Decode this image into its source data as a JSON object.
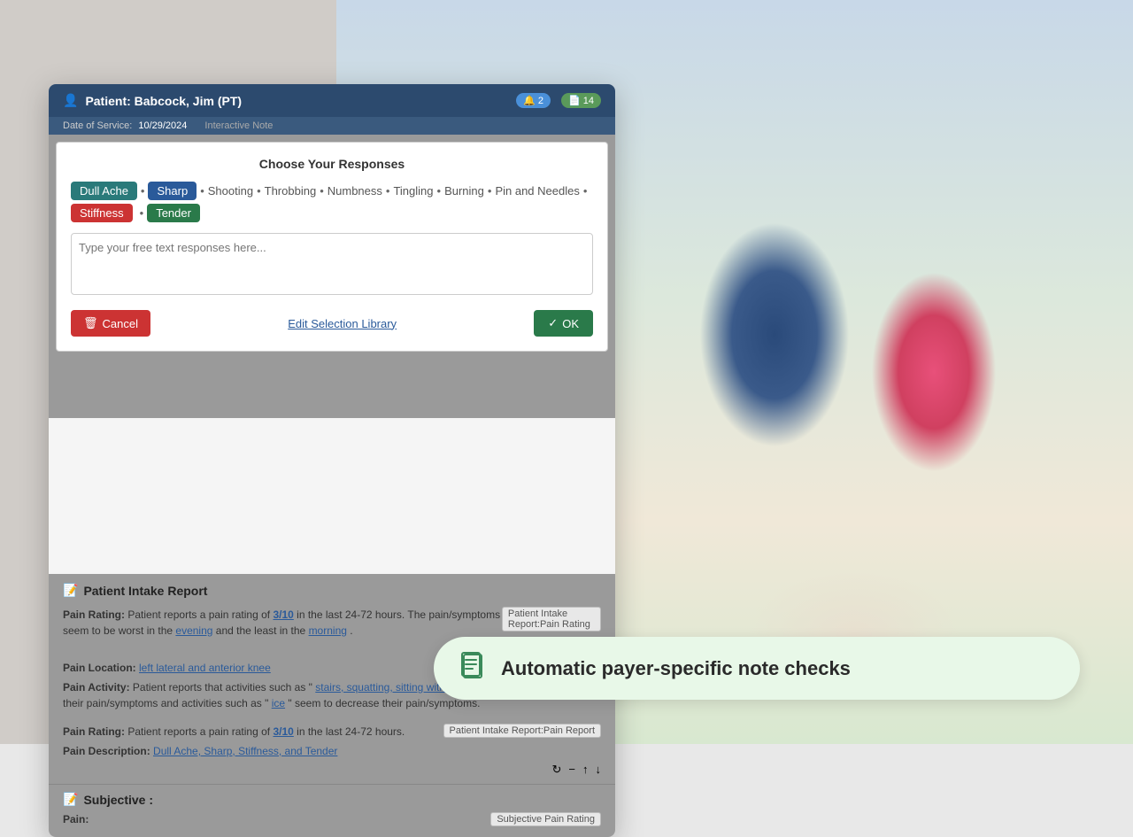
{
  "background": {
    "left_color": "#b0b0b0",
    "right_description": "photo of adult and child at table"
  },
  "patient_header": {
    "icon": "person",
    "title": "Patient: Babcock, Jim (PT)",
    "badge_alerts_count": "2",
    "badge_alerts_icon": "bell",
    "badge_docs_count": "14",
    "badge_docs_icon": "document"
  },
  "dos_bar": {
    "date_label": "Date of Service:",
    "date_value": "10/29/2024",
    "tag_label": "Interactive Note"
  },
  "modal": {
    "title": "Choose Your Responses",
    "tags": [
      {
        "label": "Dull Ache",
        "style": "selected-teal"
      },
      {
        "label": "Sharp",
        "style": "selected-blue"
      },
      {
        "label": "Shooting",
        "style": "plain"
      },
      {
        "label": "Throbbing",
        "style": "plain"
      },
      {
        "label": "Numbness",
        "style": "plain"
      },
      {
        "label": "Tingling",
        "style": "plain"
      },
      {
        "label": "Burning",
        "style": "plain"
      },
      {
        "label": "Pin and Needles",
        "style": "plain"
      },
      {
        "label": "Stiffness",
        "style": "selected-red"
      },
      {
        "label": "Tender",
        "style": "selected-green"
      }
    ],
    "textarea_placeholder": "Type your free text responses here...",
    "cancel_label": "Cancel",
    "ok_label": "OK",
    "edit_library_label": "Edit Selection Library"
  },
  "patient_intake": {
    "header": "Patient Intake Report",
    "row1": {
      "label": "Pain Rating:",
      "text1": "Patient reports a pain rating of",
      "rating": "3/10",
      "text2": "in the last 24-72 hours. The pain/symptoms seem to be worst in the",
      "worst_time": "evening",
      "text3": "and the least in the",
      "best_time": "morning",
      "tag": "Patient Intake Report:Pain Rating"
    },
    "row2": {
      "label": "Pain Location:",
      "value": "left lateral and anterior knee"
    },
    "row3": {
      "label": "Pain Activity:",
      "text1": "Patient reports that activities such as \"",
      "increase_activities": "stairs, squatting, sitting with knees bent",
      "text2": "\" seem to increase their pain/symptoms and activities such as \"",
      "decrease_activities": "ice",
      "text3": "\" seem to decrease their pain/symptoms."
    },
    "row4": {
      "label": "Pain Rating:",
      "text1": "Patient reports a pain rating of",
      "rating": "3/10",
      "text2": "in the last 24-72 hours.",
      "tag": "Patient Intake Report:Pain Report"
    },
    "row5": {
      "label": "Pain Description:",
      "value": "Dull Ache, Sharp, Stiffness, and Tender"
    }
  },
  "subjective": {
    "header": "Subjective :",
    "row1": {
      "label": "Pain:",
      "tag": "Subjective Pain Rating"
    }
  },
  "notification": {
    "icon": "📋",
    "text": "Automatic payer-specific note checks"
  }
}
